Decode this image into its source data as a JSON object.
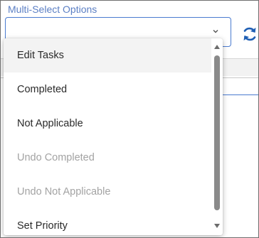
{
  "field": {
    "label": "Multi-Select Options",
    "value": "",
    "chevron_icon": "chevron-down-icon"
  },
  "refresh": {
    "icon": "refresh-icon",
    "color": "#1f5fb4"
  },
  "dropdown": {
    "items": [
      {
        "label": "Edit Tasks",
        "state": "highlighted"
      },
      {
        "label": "Completed",
        "state": "enabled"
      },
      {
        "label": "Not Applicable",
        "state": "enabled"
      },
      {
        "label": "Undo Completed",
        "state": "disabled"
      },
      {
        "label": "Undo Not Applicable",
        "state": "disabled"
      },
      {
        "label": "Set Priority",
        "state": "enabled"
      }
    ],
    "scroll_position": 0
  },
  "colors": {
    "accent": "#4a7bd0",
    "label_text": "#5b7fc4",
    "item_text": "#2a2a2a",
    "disabled_text": "#a3a3a3",
    "highlight_bg": "#f3f3f3"
  }
}
